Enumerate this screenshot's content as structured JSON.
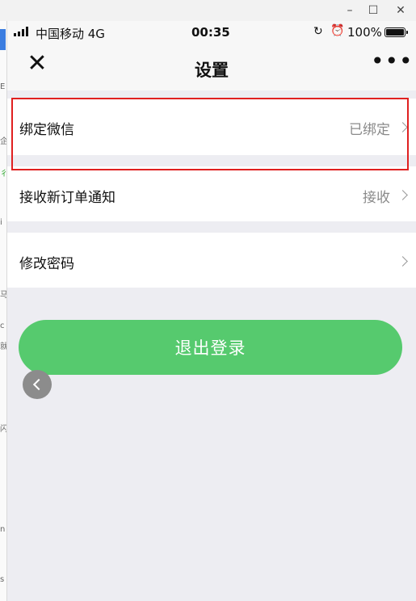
{
  "window": {
    "minimize_glyph": "–",
    "maximize_glyph": "☐",
    "close_glyph": "✕"
  },
  "side_marks": [
    "E",
    "企",
    "彳",
    "i",
    "ti",
    "马",
    "c",
    "就",
    "^",
    "闪",
    "n",
    "s",
    "人"
  ],
  "status_bar": {
    "carrier": "中国移动  4G",
    "time": "00:35",
    "rotation_lock_icon": "↻",
    "alarm_icon": "⏰",
    "battery_percent": "100%"
  },
  "nav": {
    "title": "设置",
    "close_icon": "✕",
    "more_icon": "•••"
  },
  "settings": [
    {
      "label": "绑定微信",
      "value": "已绑定"
    },
    {
      "label": "接收新订单通知",
      "value": "接收"
    },
    {
      "label": "修改密码",
      "value": ""
    }
  ],
  "logout_label": "退出登录",
  "colors": {
    "accent_green": "#56ca6e",
    "highlight_red": "#e02020",
    "background": "#ededf2"
  }
}
